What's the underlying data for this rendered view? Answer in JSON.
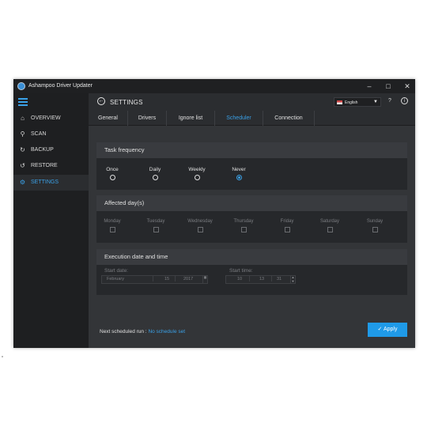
{
  "window": {
    "title": "Ashampoo Driver Updater"
  },
  "sidebar": {
    "items": [
      {
        "label": "OVERVIEW",
        "icon": "home-icon"
      },
      {
        "label": "SCAN",
        "icon": "search-icon"
      },
      {
        "label": "BACKUP",
        "icon": "backup-icon"
      },
      {
        "label": "RESTORE",
        "icon": "restore-icon"
      },
      {
        "label": "SETTINGS",
        "icon": "gear-icon",
        "active": true
      }
    ]
  },
  "header": {
    "title": "SETTINGS",
    "language": "English"
  },
  "tabs": [
    {
      "label": "General"
    },
    {
      "label": "Drivers"
    },
    {
      "label": "Ignore list"
    },
    {
      "label": "Scheduler",
      "active": true
    },
    {
      "label": "Connection"
    }
  ],
  "task_frequency": {
    "title": "Task frequency",
    "options": [
      "Once",
      "Daily",
      "Weekly",
      "Never"
    ],
    "selected": "Never"
  },
  "affected_days": {
    "title": "Affected day(s)",
    "days": [
      "Monday",
      "Tuesday",
      "Wednesday",
      "Thursday",
      "Friday",
      "Saturday",
      "Sunday"
    ]
  },
  "execution": {
    "title": "Execution date and time",
    "start_date_label": "Start date:",
    "start_date": {
      "month": "February",
      "day": "15",
      "year": "2017"
    },
    "start_time_label": "Start time:",
    "start_time": {
      "hour": "10",
      "minute": "13",
      "second": "31"
    }
  },
  "footer": {
    "next_run_label": "Next scheduled run :",
    "next_run_value": "No schedule set",
    "apply_label": "Apply"
  },
  "colors": {
    "accent": "#3aa0e6",
    "button": "#1f9ae8",
    "background": "#2b2d30",
    "sidebar": "#1e1f21"
  }
}
